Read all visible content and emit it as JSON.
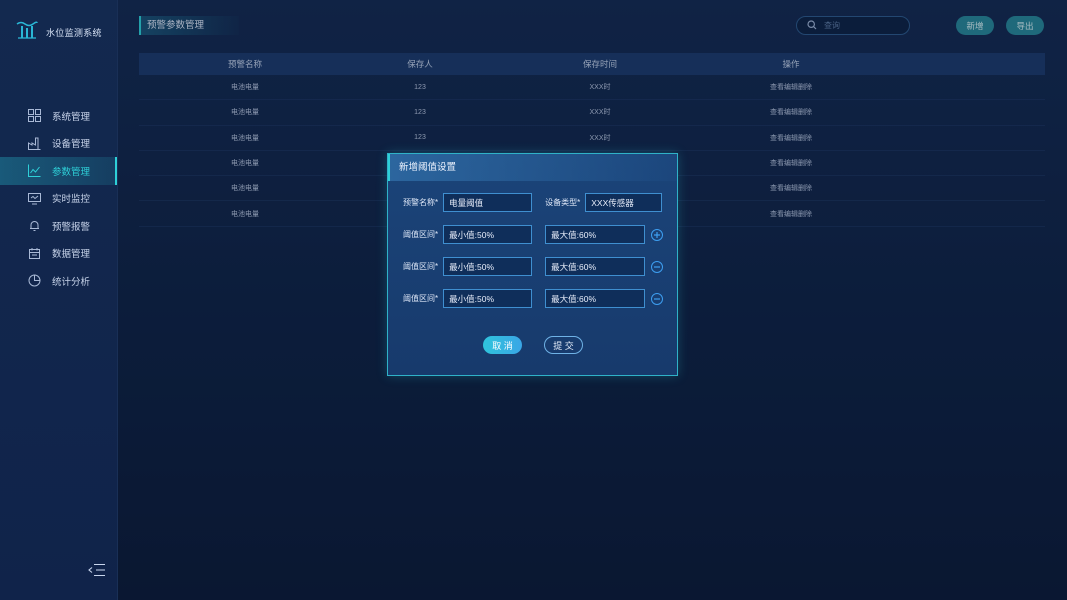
{
  "app": {
    "title": "水位监测系统"
  },
  "sidebar": {
    "items": [
      {
        "label": "系统管理",
        "icon": "grid-icon"
      },
      {
        "label": "设备管理",
        "icon": "factory-icon"
      },
      {
        "label": "参数管理",
        "icon": "chart-line-icon",
        "active": true
      },
      {
        "label": "实时监控",
        "icon": "monitor-icon"
      },
      {
        "label": "预警报警",
        "icon": "bell-icon"
      },
      {
        "label": "数据管理",
        "icon": "calendar-icon"
      },
      {
        "label": "统计分析",
        "icon": "pie-chart-icon"
      }
    ]
  },
  "header": {
    "page_title": "预警参数管理",
    "search_placeholder": "查询",
    "add_label": "新增",
    "export_label": "导出"
  },
  "table": {
    "headers": [
      "预警名称",
      "保存人",
      "保存时间",
      "操作"
    ],
    "rows": [
      [
        "电池电量",
        "123",
        "XXX时",
        "查看编辑删除"
      ],
      [
        "电池电量",
        "123",
        "XXX时",
        "查看编辑删除"
      ],
      [
        "电池电量",
        "123",
        "XXX时",
        "查看编辑删除"
      ],
      [
        "电池电量",
        "",
        "",
        "查看编辑删除"
      ],
      [
        "电池电量",
        "",
        "",
        "查看编辑删除"
      ],
      [
        "电池电量",
        "",
        "",
        "查看编辑删除"
      ]
    ]
  },
  "dialog": {
    "title": "新增阈值设置",
    "name_label": "预警名称*",
    "name_value": "电量阈值",
    "type_label": "设备类型*",
    "type_value": "XXX传感器",
    "range_label": "阈值区间*",
    "ranges": [
      {
        "min": "最小值:50%",
        "max": "最大值:60%",
        "action": "add"
      },
      {
        "min": "最小值:50%",
        "max": "最大值:60%",
        "action": "remove"
      },
      {
        "min": "最小值:50%",
        "max": "最大值:60%",
        "action": "remove"
      }
    ],
    "cancel_label": "取 消",
    "submit_label": "提 交"
  },
  "colors": {
    "accent": "#2ed0d8",
    "background": "#0e2245",
    "header_row": "#1b3a6c",
    "dialog_border": "#2fb2c8"
  }
}
